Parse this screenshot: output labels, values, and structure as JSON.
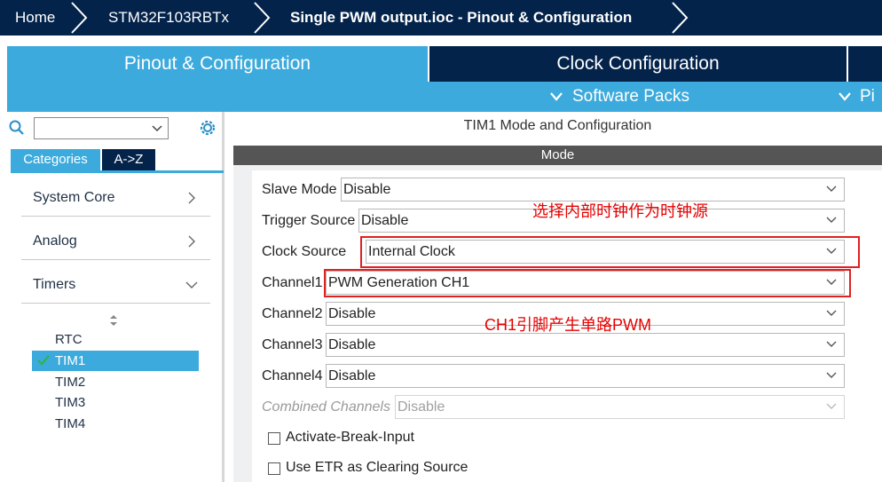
{
  "breadcrumb": {
    "home": "Home",
    "device": "STM32F103RBTx",
    "file": "Single PWM output.ioc - Pinout & Configuration"
  },
  "tabs": {
    "pinout": "Pinout & Configuration",
    "clock": "Clock Configuration"
  },
  "subtabs": {
    "software_packs": "Software Packs",
    "pinout_cut": "Pi"
  },
  "left": {
    "search_value": "",
    "category_tabs": [
      "Categories",
      "A->Z"
    ],
    "categories": [
      "System Core",
      "Analog",
      "Timers"
    ],
    "timers": [
      "RTC",
      "TIM1",
      "TIM2",
      "TIM3",
      "TIM4"
    ],
    "selected_timer": "TIM1"
  },
  "panel": {
    "title": "TIM1 Mode and Configuration",
    "section": "Mode"
  },
  "fields": [
    {
      "label": "Slave Mode",
      "value": "Disable"
    },
    {
      "label": "Trigger Source",
      "value": "Disable"
    },
    {
      "label": "Clock Source",
      "value": "Internal Clock"
    },
    {
      "label": "Channel1",
      "value": "PWM Generation CH1"
    },
    {
      "label": "Channel2",
      "value": "Disable"
    },
    {
      "label": "Channel3",
      "value": "Disable"
    },
    {
      "label": "Channel4",
      "value": "Disable"
    },
    {
      "label": "Combined Channels",
      "value": "Disable"
    }
  ],
  "checkboxes": [
    {
      "label": "Activate-Break-Input",
      "checked": false
    },
    {
      "label": "Use ETR as Clearing Source",
      "checked": false
    }
  ],
  "annotations": {
    "clock_note": "选择内部时钟作为时钟源",
    "channel_note": "CH1引脚产生单路PWM"
  },
  "colors": {
    "navy": "#03234b",
    "accent": "#3caadc",
    "annotation": "#e60000"
  }
}
